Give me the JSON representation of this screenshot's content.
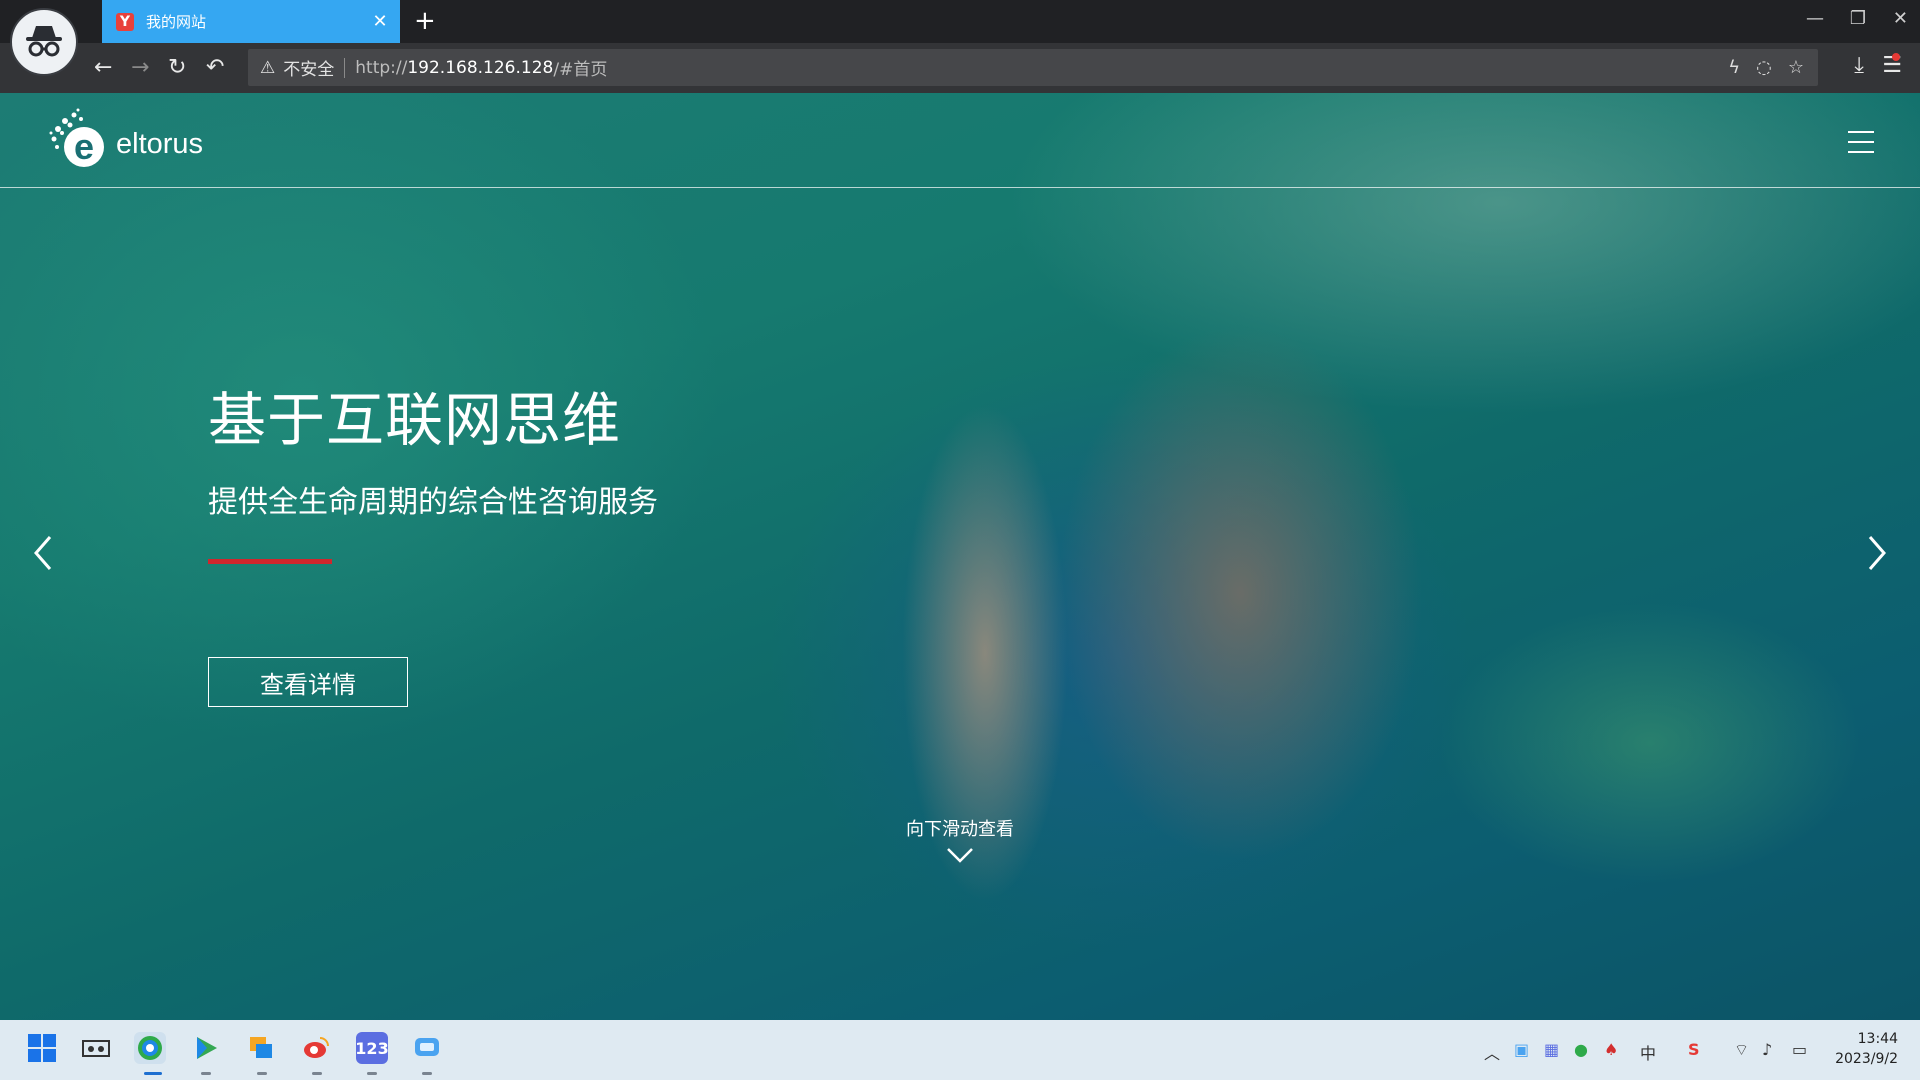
{
  "browser": {
    "tab_title": "我的网站",
    "tab_favicon": "Y",
    "new_tab": "+",
    "security_label": "不安全",
    "url_prefix": "http://",
    "url_host": "192.168.126.128",
    "url_path": "/#首页"
  },
  "site": {
    "logo_text": "eltorus",
    "logo_letter": "e",
    "headline": "基于互联网思维",
    "subheadline": "提供全生命周期的综合性咨询服务",
    "cta_label": "查看详情",
    "scroll_hint": "向下滑动查看",
    "accent_color": "#d0262d"
  },
  "taskbar": {
    "time": "13:44",
    "date": "2023/9/2",
    "ime_label": "中"
  }
}
